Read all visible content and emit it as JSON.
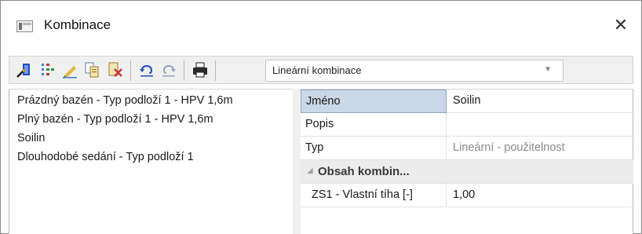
{
  "window": {
    "title": "Kombinace",
    "close_glyph": "✕"
  },
  "toolbar": {
    "buttons": [
      "new-combination-icon",
      "generate-icon",
      "edit-icon",
      "copy-icon",
      "delete-icon",
      "undo-icon",
      "redo-icon",
      "print-icon"
    ],
    "combination_type": "Lineární kombinace"
  },
  "combinations": [
    "Prázdný bazén - Typ podloží 1 - HPV 1,6m",
    "Plný bazén - Typ podloží 1 - HPV 1,6m",
    "Soilin",
    "Dlouhodobé sedání - Typ podloží 1"
  ],
  "properties": {
    "name_label": "Jméno",
    "name_value": "Soilin",
    "description_label": "Popis",
    "description_value": "",
    "type_label": "Typ",
    "type_value": "Lineární - použitelnost",
    "group_label": "Obsah kombin...",
    "load_case_label": "ZS1 - Vlastní tíha [-]",
    "load_case_value": "1,00"
  },
  "colors": {
    "selected_cell": "#cad7e6",
    "group_background": "#ececec",
    "toolbar_background": "#f0f0f0"
  }
}
